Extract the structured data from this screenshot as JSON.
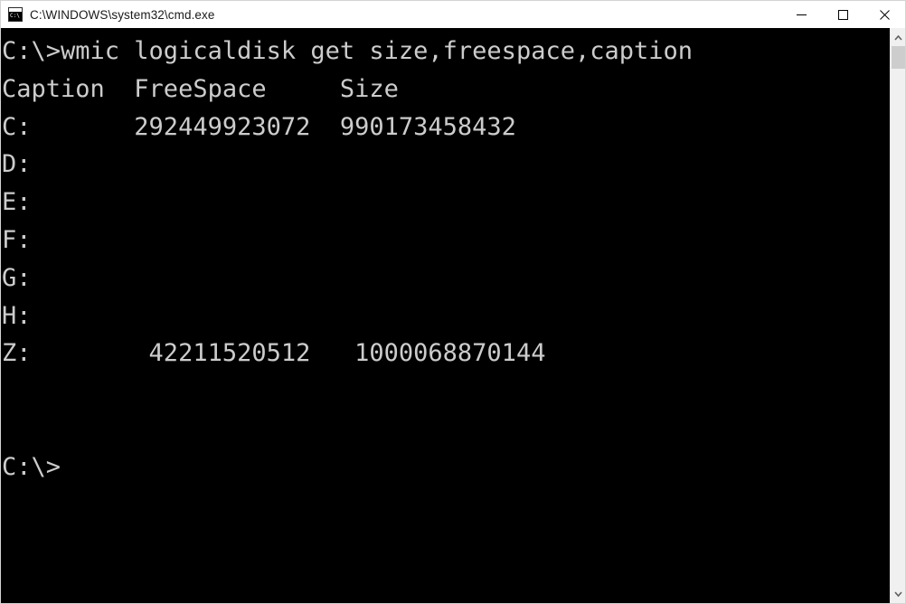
{
  "window": {
    "title": "C:\\WINDOWS\\system32\\cmd.exe",
    "app_icon_label": "C:\\",
    "background_color": "#000000",
    "text_color": "#cccccc",
    "titlebar_color": "#ffffff"
  },
  "controls": {
    "minimize_label": "Minimize",
    "maximize_label": "Maximize",
    "close_label": "Close"
  },
  "scrollbar": {
    "up_arrow_label": "Scroll up",
    "down_arrow_label": "Scroll down",
    "thumb_label": "Scroll thumb"
  },
  "terminal": {
    "prompt": "C:\\>",
    "command": "wmic logicaldisk get size,freespace,caption",
    "columns": [
      "Caption",
      "FreeSpace",
      "Size"
    ],
    "rows": [
      {
        "caption": "C:",
        "freespace": "292449923072",
        "size": "990173458432"
      },
      {
        "caption": "D:",
        "freespace": "",
        "size": ""
      },
      {
        "caption": "E:",
        "freespace": "",
        "size": ""
      },
      {
        "caption": "F:",
        "freespace": "",
        "size": ""
      },
      {
        "caption": "G:",
        "freespace": "",
        "size": ""
      },
      {
        "caption": "H:",
        "freespace": "",
        "size": ""
      },
      {
        "caption": "Z:",
        "freespace": "42211520512",
        "size": "1000068870144"
      }
    ],
    "trailing_prompt": "C:\\>",
    "screen_text": "C:\\>wmic logicaldisk get size,freespace,caption\nCaption  FreeSpace     Size\nC:       292449923072  990173458432\nD:\nE:\nF:\nG:\nH:\nZ:        42211520512   1000068870144\n\n\nC:\\>"
  }
}
